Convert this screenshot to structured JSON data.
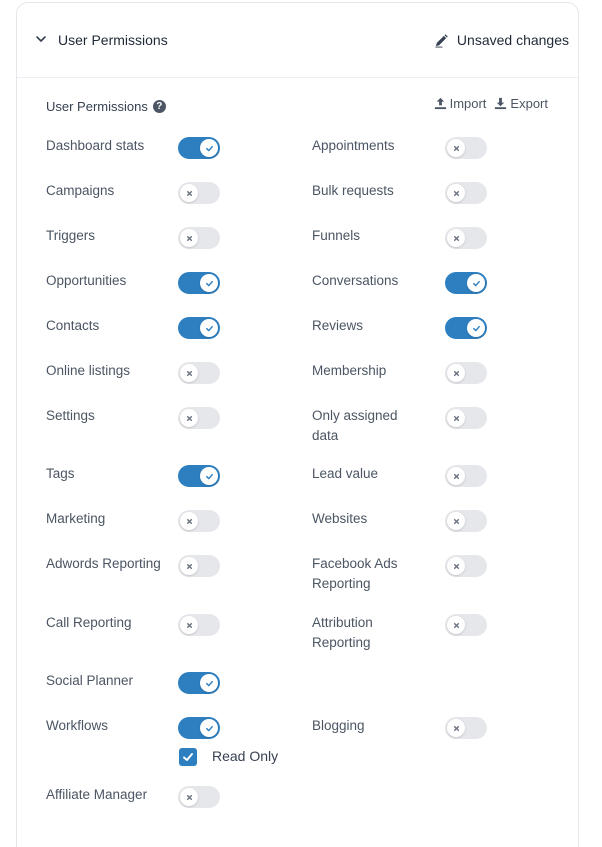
{
  "header": {
    "title": "User Permissions",
    "status": "Unsaved changes"
  },
  "section": {
    "title": "User Permissions",
    "help_glyph": "?",
    "import_label": "Import",
    "export_label": "Export"
  },
  "permissions": [
    {
      "label": "Dashboard stats",
      "on": true
    },
    {
      "label": "Appointments",
      "on": false
    },
    {
      "label": "Campaigns",
      "on": false
    },
    {
      "label": "Bulk requests",
      "on": false
    },
    {
      "label": "Triggers",
      "on": false
    },
    {
      "label": "Funnels",
      "on": false
    },
    {
      "label": "Opportunities",
      "on": true
    },
    {
      "label": "Conversations",
      "on": true
    },
    {
      "label": "Contacts",
      "on": true
    },
    {
      "label": "Reviews",
      "on": true
    },
    {
      "label": "Online listings",
      "on": false
    },
    {
      "label": "Membership",
      "on": false
    },
    {
      "label": "Settings",
      "on": false
    },
    {
      "label": "Only assigned data",
      "on": false
    },
    {
      "label": "Tags",
      "on": true
    },
    {
      "label": "Lead value",
      "on": false
    },
    {
      "label": "Marketing",
      "on": false
    },
    {
      "label": "Websites",
      "on": false
    },
    {
      "label": "Adwords Reporting",
      "on": false
    },
    {
      "label": "Facebook Ads Reporting",
      "on": false
    },
    {
      "label": "Call Reporting",
      "on": false
    },
    {
      "label": "Attribution Reporting",
      "on": false
    },
    {
      "label": "Social Planner",
      "on": true
    },
    {
      "label": "Workflows",
      "on": true
    },
    {
      "label": "Blogging",
      "on": false
    },
    {
      "label": "Affiliate Manager",
      "on": false
    }
  ],
  "workflows_read_only": {
    "label": "Read Only",
    "checked": true
  },
  "colors": {
    "accent": "#2d7fc0",
    "toggle_off": "#e5e7eb",
    "text": "#4b5563"
  }
}
